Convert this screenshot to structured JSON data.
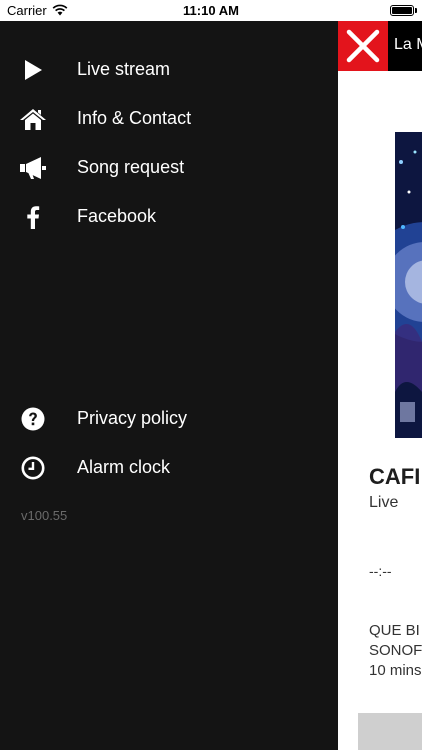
{
  "status_bar": {
    "carrier": "Carrier",
    "time": "11:10 AM"
  },
  "drawer": {
    "items": [
      {
        "label": "Live stream",
        "icon": "play-icon"
      },
      {
        "label": "Info & Contact",
        "icon": "home-icon"
      },
      {
        "label": "Song request",
        "icon": "megaphone-icon"
      },
      {
        "label": "Facebook",
        "icon": "facebook-icon"
      },
      {
        "label": "Privacy policy",
        "icon": "question-circle-icon"
      },
      {
        "label": "Alarm clock",
        "icon": "clock-icon"
      }
    ],
    "version": "v100.55"
  },
  "main": {
    "title": "La M",
    "station_name": "CAFI",
    "station_subtitle": "Live",
    "time_display": "--:--",
    "info_lines": [
      "QUE BI",
      "SONOF",
      "10 mins"
    ]
  },
  "colors": {
    "drawer_bg": "#141414",
    "close_red": "#e3141c"
  }
}
